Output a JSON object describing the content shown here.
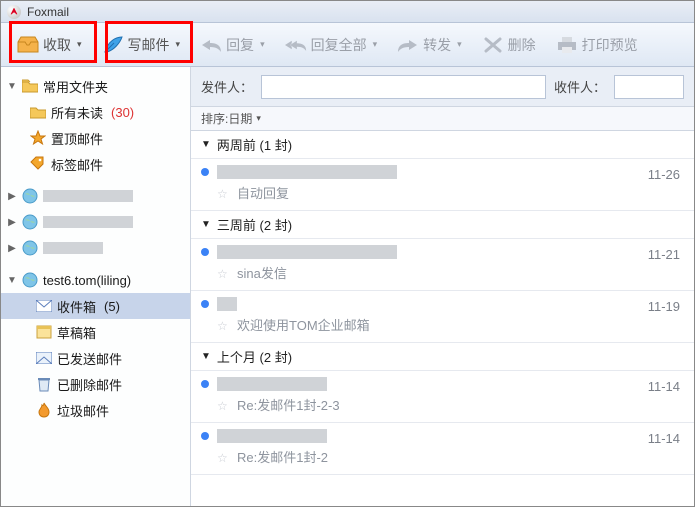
{
  "app_title": "Foxmail",
  "toolbar": {
    "receive": "收取",
    "compose": "写邮件",
    "reply": "回复",
    "reply_all": "回复全部",
    "forward": "转发",
    "delete": "删除",
    "print_preview": "打印预览"
  },
  "sidebar": {
    "common_folders": "常用文件夹",
    "all_unread": "所有未读",
    "all_unread_count": "(30)",
    "pinned": "置顶邮件",
    "tagged": "标签邮件",
    "account": "test6.tom(liling)",
    "inbox": "收件箱",
    "inbox_count": "(5)",
    "drafts": "草稿箱",
    "sent": "已发送邮件",
    "deleted": "已删除邮件",
    "junk": "垃圾邮件"
  },
  "filter": {
    "sender_label": "发件人：",
    "recipient_label": "收件人："
  },
  "sort": {
    "label": "排序:日期"
  },
  "groups": [
    {
      "label": "两周前 (1 封)"
    },
    {
      "label": "三周前 (2 封)"
    },
    {
      "label": "上个月 (2 封)"
    }
  ],
  "mails": [
    {
      "group": 0,
      "date": "11-26",
      "subject": "自动回复"
    },
    {
      "group": 1,
      "date": "11-21",
      "subject": "sina发信"
    },
    {
      "group": 1,
      "date": "11-19",
      "subject": "欢迎使用TOM企业邮箱"
    },
    {
      "group": 2,
      "date": "11-14",
      "subject": "Re:发邮件1封-2-3"
    },
    {
      "group": 2,
      "date": "11-14",
      "subject": "Re:发邮件1封-2"
    }
  ]
}
